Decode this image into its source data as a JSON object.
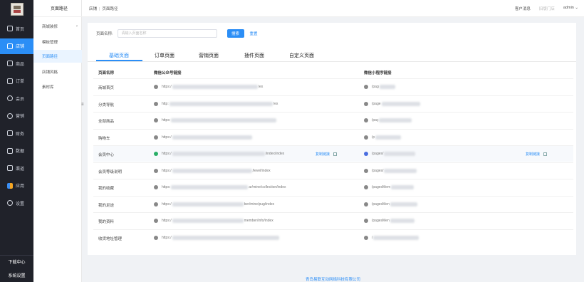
{
  "sidebar": {
    "items": [
      {
        "label": "首页",
        "icon": "home-icon"
      },
      {
        "label": "店铺",
        "icon": "store-icon",
        "active": true
      },
      {
        "label": "商品",
        "icon": "goods-icon"
      },
      {
        "label": "订单",
        "icon": "order-icon"
      },
      {
        "label": "会员",
        "icon": "member-icon"
      },
      {
        "label": "营销",
        "icon": "marketing-icon"
      },
      {
        "label": "财务",
        "icon": "finance-icon"
      },
      {
        "label": "数据",
        "icon": "data-icon"
      },
      {
        "label": "渠道",
        "icon": "channel-icon"
      },
      {
        "label": "应用",
        "icon": "apps-icon"
      },
      {
        "label": "设置",
        "icon": "gear-icon"
      }
    ],
    "bottom": {
      "download": "下载中心",
      "system": "系统设置"
    }
  },
  "subnav": {
    "title": "页面路径",
    "items": [
      {
        "label": "商城装修",
        "has_chevron": true
      },
      {
        "label": "模板管理"
      },
      {
        "label": "页面路径",
        "active": true
      },
      {
        "label": "店铺风格"
      },
      {
        "label": "素材库"
      }
    ],
    "collapse": "≡"
  },
  "header": {
    "breadcrumb": [
      "店铺",
      "页面路径"
    ],
    "customer_msg": "客户消息",
    "store": "旧版门店",
    "user": "admin"
  },
  "search": {
    "label": "页面名称:",
    "placeholder": "请输入页面名称",
    "button": "搜索",
    "reset": "重置"
  },
  "tabs": [
    "基础页面",
    "订单页面",
    "营销页面",
    "插件页面",
    "自定义页面"
  ],
  "table": {
    "headers": [
      "页面名称",
      "微信公众号链接",
      "微信小程序链接"
    ],
    "copy_label": "复制链接",
    "rows": [
      {
        "name": "商城首页",
        "wx_prefix": "https:/",
        "wx_suffix": "/ex",
        "mp_prefix": "/pag",
        "mp_suffix": ""
      },
      {
        "name": "分类导航",
        "wx_prefix": "http:",
        "wx_suffix": "/ex",
        "mp_prefix": "/page",
        "mp_suffix": ""
      },
      {
        "name": "全部商品",
        "wx_prefix": "https:",
        "wx_suffix": "",
        "mp_prefix": "/paç",
        "mp_suffix": ""
      },
      {
        "name": "购物车",
        "wx_prefix": "https:/",
        "wx_suffix": "",
        "mp_prefix": "/p",
        "mp_suffix": ""
      },
      {
        "name": "会员中心",
        "wx_prefix": "https:/",
        "wx_suffix": "/index/index",
        "mp_prefix": "/pages/",
        "mp_suffix": "",
        "highlight": true
      },
      {
        "name": "会员等级说明",
        "wx_prefix": "https:/",
        "wx_suffix": "/level/index",
        "mp_prefix": "/pages/",
        "mp_suffix": ""
      },
      {
        "name": "我的收藏",
        "wx_prefix": "https:",
        "wx_suffix": "ar/mine/collection/index",
        "mp_prefix": "/pagesMem",
        "mp_suffix": ""
      },
      {
        "name": "我的足迹",
        "wx_prefix": "https:/",
        "wx_suffix": "ber/mine/pug/index",
        "mp_prefix": "/pagesMen",
        "mp_suffix": ""
      },
      {
        "name": "我的资料",
        "wx_prefix": "https:/",
        "wx_suffix": "member/info/index",
        "mp_prefix": "/pagesMen",
        "mp_suffix": ""
      },
      {
        "name": "收货地址管理",
        "wx_prefix": "https:/",
        "wx_suffix": "",
        "mp_prefix": "/",
        "mp_suffix": ""
      }
    ]
  },
  "footer": "青岛易联互动网络科技有限公司",
  "colors": {
    "accent": "#2b8ef6",
    "sidebar": "#20222a"
  }
}
